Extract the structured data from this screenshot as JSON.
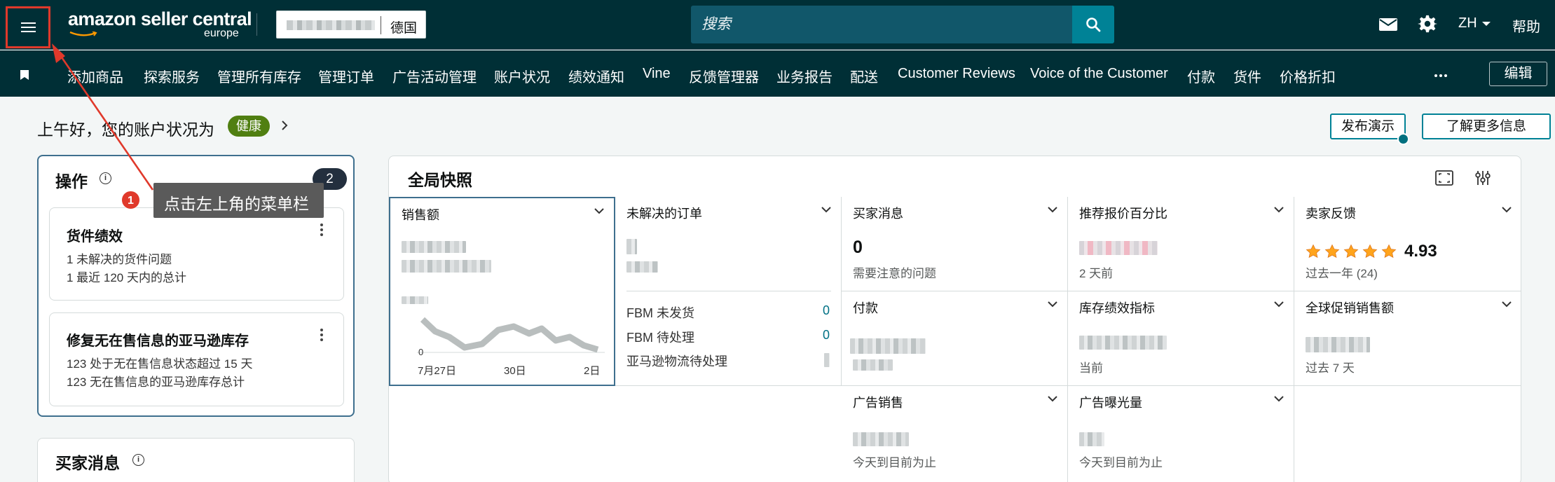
{
  "topbar": {
    "logo_main": "amazon seller central",
    "logo_sub": "europe",
    "store_country": "德国",
    "search_placeholder": "搜索",
    "lang": "ZH",
    "help": "帮助"
  },
  "nav": {
    "items": [
      "添加商品",
      "探索服务",
      "管理所有库存",
      "管理订单",
      "广告活动管理",
      "账户状况",
      "绩效通知",
      "Vine",
      "反馈管理器",
      "业务报告",
      "配送",
      "Customer Reviews",
      "Voice of the Customer",
      "付款",
      "货件",
      "价格折扣"
    ],
    "edit": "编辑"
  },
  "greeting": {
    "text": "上午好，您的账户状况为",
    "status": "健康",
    "btn_demo": "发布演示",
    "btn_learn": "了解更多信息"
  },
  "actions": {
    "title": "操作",
    "count": "2",
    "cards": [
      {
        "title": "货件绩效",
        "lines": [
          "1  未解决的货件问题",
          "1  最近 120 天内的总计"
        ]
      },
      {
        "title": "修复无在售信息的亚马逊库存",
        "lines": [
          "123  处于无在售信息状态超过 15 天",
          "123  无在售信息的亚马逊库存总计"
        ]
      }
    ]
  },
  "buyer_messages_panel": {
    "title": "买家消息"
  },
  "snapshot": {
    "title": "全局快照",
    "sales": {
      "label": "销售额",
      "axis_zero": "0",
      "x_ticks": [
        "7月27日",
        "30日",
        "2日"
      ]
    },
    "open_orders": {
      "label": "未解决的订单",
      "rows": [
        {
          "label": "FBM 未发货",
          "value": "0"
        },
        {
          "label": "FBM 待处理",
          "value": "0"
        },
        {
          "label": "亚马逊物流待处理",
          "value": ""
        }
      ]
    },
    "buyer_messages": {
      "label": "买家消息",
      "value": "0",
      "sub": "需要注意的问题"
    },
    "featured_offer": {
      "label": "推荐报价百分比",
      "sub": "2 天前"
    },
    "seller_feedback": {
      "label": "卖家反馈",
      "rating": "4.93",
      "sub": "过去一年 (24)",
      "stars": 5
    },
    "payments": {
      "label": "付款"
    },
    "inventory": {
      "label": "库存绩效指标",
      "sub": "当前"
    },
    "global_promo": {
      "label": "全球促销销售额",
      "sub": "过去 7 天"
    },
    "ad_sales": {
      "label": "广告销售",
      "sub": "今天到目前为止"
    },
    "ad_impressions": {
      "label": "广告曝光量",
      "sub": "今天到目前为止"
    }
  },
  "callout": {
    "step": "1",
    "text": "点击左上角的菜单栏"
  },
  "colors": {
    "topbar": "#002f36",
    "accent": "#008296",
    "health": "#507f11",
    "callout_red": "#e0392b",
    "star": "#ffa41c"
  }
}
